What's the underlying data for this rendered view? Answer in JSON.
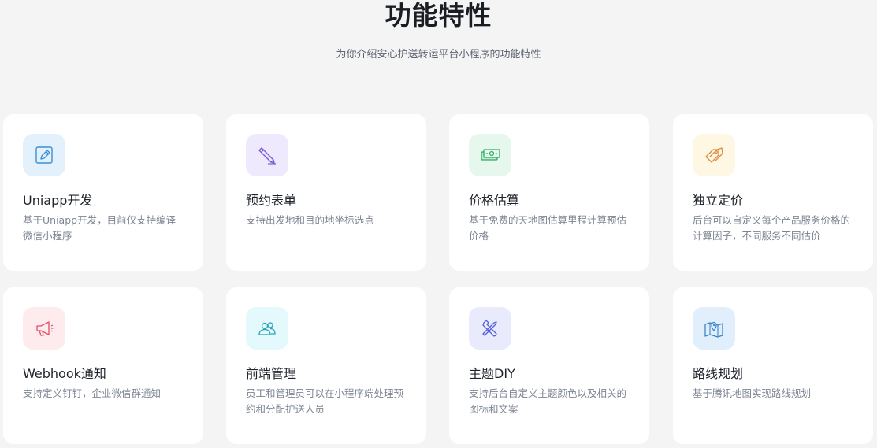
{
  "header": {
    "title": "功能特性",
    "subtitle": "为你介绍安心护送转运平台小程序的功能特性"
  },
  "features": [
    {
      "title": "Uniapp开发",
      "desc": "基于Uniapp开发，目前仅支持编译微信小程序",
      "icon": "edit-icon",
      "icon_bg": "#e3f1fd",
      "icon_color": "#3a8fd6"
    },
    {
      "title": "预约表单",
      "desc": "支持出发地和目的地坐标选点",
      "icon": "pencil-icon",
      "icon_bg": "#efe9fd",
      "icon_color": "#7b57d9"
    },
    {
      "title": "价格估算",
      "desc": "基于免费的天地图估算里程计算预估价格",
      "icon": "money-icon",
      "icon_bg": "#e6f8ee",
      "icon_color": "#2faa62"
    },
    {
      "title": "独立定价",
      "desc": "后台可以自定义每个产品服务价格的计算因子，不同服务不同估价",
      "icon": "price-tag-icon",
      "icon_bg": "#fdf7e3",
      "icon_color": "#e08a3c"
    },
    {
      "title": "Webhook通知",
      "desc": "支持定义钉钉，企业微信群通知",
      "icon": "megaphone-icon",
      "icon_bg": "#fdebee",
      "icon_color": "#e05068"
    },
    {
      "title": "前端管理",
      "desc": "员工和管理员可以在小程序端处理预约和分配护送人员",
      "icon": "users-icon",
      "icon_bg": "#e3f9fb",
      "icon_color": "#2aa3b8"
    },
    {
      "title": "主题DIY",
      "desc": "支持后台自定义主题颜色以及相关的图标和文案",
      "icon": "tools-icon",
      "icon_bg": "#e9ebfd",
      "icon_color": "#5561d6"
    },
    {
      "title": "路线规划",
      "desc": "基于腾讯地图实现路线规划",
      "icon": "map-icon",
      "icon_bg": "#e1effc",
      "icon_color": "#3a86c8"
    }
  ]
}
